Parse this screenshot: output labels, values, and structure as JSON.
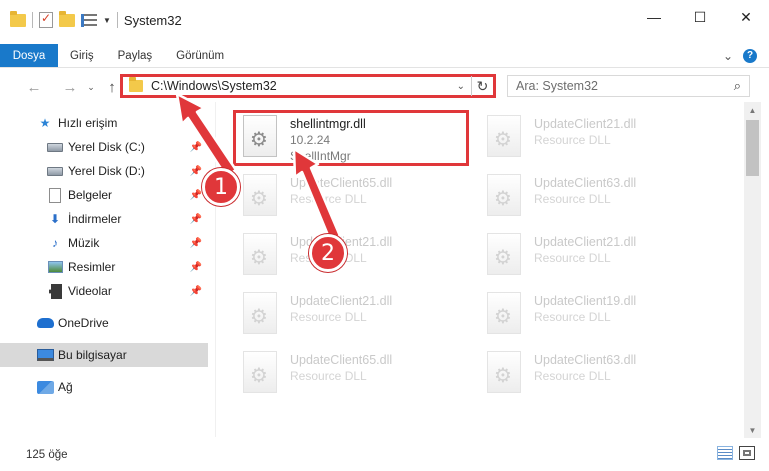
{
  "window": {
    "title": "System32",
    "controls": {
      "minimize": "—",
      "maximize": "☐",
      "close": "✕"
    }
  },
  "ribbon": {
    "tabs": [
      "Dosya",
      "Giriş",
      "Paylaş",
      "Görünüm"
    ],
    "expand_glyph": "⌄",
    "help_glyph": "?"
  },
  "nav": {
    "back": "←",
    "forward": "→",
    "recent": "⌄",
    "up": "↑",
    "address": "C:\\Windows\\System32",
    "address_dropdown": "⌄",
    "refresh": "↻",
    "search_placeholder": "Ara: System32",
    "search_glyph": "⌕"
  },
  "sidebar": {
    "items": [
      {
        "label": "Hızlı erişim",
        "icon": "star-icon"
      },
      {
        "label": "Yerel Disk (C:)",
        "icon": "drive-icon",
        "pinned": true
      },
      {
        "label": "Yerel Disk (D:)",
        "icon": "drive-icon",
        "pinned": true
      },
      {
        "label": "Belgeler",
        "icon": "documents-icon",
        "pinned": true
      },
      {
        "label": "İndirmeler",
        "icon": "downloads-icon",
        "pinned": true
      },
      {
        "label": "Müzik",
        "icon": "music-icon",
        "pinned": true
      },
      {
        "label": "Resimler",
        "icon": "pictures-icon",
        "pinned": true
      },
      {
        "label": "Videolar",
        "icon": "videos-icon",
        "pinned": true
      },
      {
        "label": "OneDrive",
        "icon": "cloud-icon"
      },
      {
        "label": "Bu bilgisayar",
        "icon": "computer-icon",
        "selected": true
      },
      {
        "label": "Ağ",
        "icon": "network-icon"
      }
    ],
    "pin_glyph": "📌"
  },
  "files": [
    {
      "name": "shellintmgr.dll",
      "line2": "10.2.24",
      "line3": "ShellIntMgr",
      "highlighted": true
    },
    {
      "name": "UpdateClient21.dll",
      "line2": "Resource DLL"
    },
    {
      "name": "UpdateClient65.dll",
      "line2": "Resource DLL"
    },
    {
      "name": "UpdateClient63.dll",
      "line2": "Resource DLL"
    },
    {
      "name": "UpdateClient21.dll",
      "line2": "Resource DLL"
    },
    {
      "name": "UpdateClient21.dll",
      "line2": "Resource DLL"
    },
    {
      "name": "UpdateClient21.dll",
      "line2": "Resource DLL"
    },
    {
      "name": "UpdateClient19.dll",
      "line2": "Resource DLL"
    },
    {
      "name": "UpdateClient65.dll",
      "line2": "Resource DLL"
    },
    {
      "name": "UpdateClient63.dll",
      "line2": "Resource DLL"
    }
  ],
  "status": {
    "item_count": "125 öğe"
  },
  "annotations": {
    "step1": "1",
    "step2": "2",
    "color": "#e0373a"
  }
}
